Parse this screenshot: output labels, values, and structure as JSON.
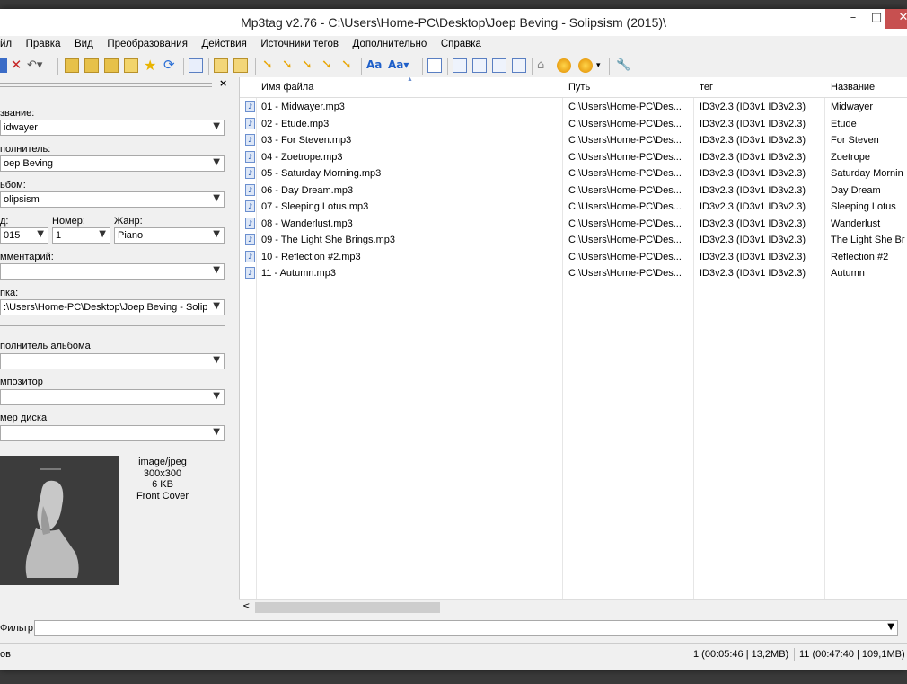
{
  "window": {
    "title": "Mp3tag v2.76  -  C:\\Users\\Home-PC\\Desktop\\Joep Beving - Solipsism (2015)\\"
  },
  "menu": [
    "йл",
    "Правка",
    "Вид",
    "Преобразования",
    "Действия",
    "Источники тегов",
    "Дополнительно",
    "Справка"
  ],
  "toolbar_icons": [
    "save-icon",
    "delete-icon",
    "undo-icon",
    "open-folder-icon",
    "add-folder-icon",
    "favorite-folder-icon",
    "star-icon",
    "refresh-icon",
    "list-icon",
    "export-icon",
    "print-icon",
    "tag-to-filename-icon",
    "filename-to-tag-icon",
    "tag-to-tag-icon",
    "text-to-tag-icon",
    "tag-sources-icon",
    "case-conversion-icon",
    "font-icon",
    "edit-icon",
    "playlist-icon",
    "autonumber-icon",
    "freedb-icon",
    "discogs-icon",
    "musicbrainz-icon",
    "web-source-icon",
    "settings-icon"
  ],
  "tag_panel": {
    "title_label": "звание:",
    "title_value": "idwayer",
    "artist_label": "полнитель:",
    "artist_value": "oep Beving",
    "album_label": "ьбом:",
    "album_value": "olipsism",
    "year_label": "д:",
    "year_value": "015",
    "track_label": "Номер:",
    "track_value": "1",
    "genre_label": "Жанр:",
    "genre_value": "Piano",
    "comment_label": "мментарий:",
    "comment_value": "",
    "folder_label": "пка:",
    "folder_value": ":\\Users\\Home-PC\\Desktop\\Joep Beving - Solipsism",
    "album_artist_label": "полнитель альбома",
    "composer_label": "мпозитор",
    "disc_label": "мер диска",
    "cover": {
      "mime": "image/jpeg",
      "size": "300x300",
      "filesize": "6 KB",
      "type": "Front Cover"
    }
  },
  "file_list": {
    "columns": [
      "Имя файла",
      "Путь",
      "тег",
      "Название"
    ],
    "rows": [
      [
        "01 - Midwayer.mp3",
        "C:\\Users\\Home-PC\\Des...",
        "ID3v2.3 (ID3v1 ID3v2.3)",
        "Midwayer"
      ],
      [
        "02 - Etude.mp3",
        "C:\\Users\\Home-PC\\Des...",
        "ID3v2.3 (ID3v1 ID3v2.3)",
        "Etude"
      ],
      [
        "03 - For Steven.mp3",
        "C:\\Users\\Home-PC\\Des...",
        "ID3v2.3 (ID3v1 ID3v2.3)",
        "For Steven"
      ],
      [
        "04 - Zoetrope.mp3",
        "C:\\Users\\Home-PC\\Des...",
        "ID3v2.3 (ID3v1 ID3v2.3)",
        "Zoetrope"
      ],
      [
        "05 - Saturday Morning.mp3",
        "C:\\Users\\Home-PC\\Des...",
        "ID3v2.3 (ID3v1 ID3v2.3)",
        "Saturday Mornin"
      ],
      [
        "06 - Day Dream.mp3",
        "C:\\Users\\Home-PC\\Des...",
        "ID3v2.3 (ID3v1 ID3v2.3)",
        "Day Dream"
      ],
      [
        "07 - Sleeping Lotus.mp3",
        "C:\\Users\\Home-PC\\Des...",
        "ID3v2.3 (ID3v1 ID3v2.3)",
        "Sleeping Lotus"
      ],
      [
        "08 - Wanderlust.mp3",
        "C:\\Users\\Home-PC\\Des...",
        "ID3v2.3 (ID3v1 ID3v2.3)",
        "Wanderlust"
      ],
      [
        "09 - The Light She Brings.mp3",
        "C:\\Users\\Home-PC\\Des...",
        "ID3v2.3 (ID3v1 ID3v2.3)",
        "The Light She Br"
      ],
      [
        "10 - Reflection #2.mp3",
        "C:\\Users\\Home-PC\\Des...",
        "ID3v2.3 (ID3v1 ID3v2.3)",
        "Reflection #2"
      ],
      [
        "11 - Autumn.mp3",
        "C:\\Users\\Home-PC\\Des...",
        "ID3v2.3 (ID3v1 ID3v2.3)",
        "Autumn"
      ]
    ]
  },
  "filter": {
    "label": "Фильтр",
    "value": ""
  },
  "status": {
    "left": "ов",
    "selection": "1 (00:05:46 | 13,2MB)",
    "total": "11 (00:47:40 | 109,1MB)"
  }
}
